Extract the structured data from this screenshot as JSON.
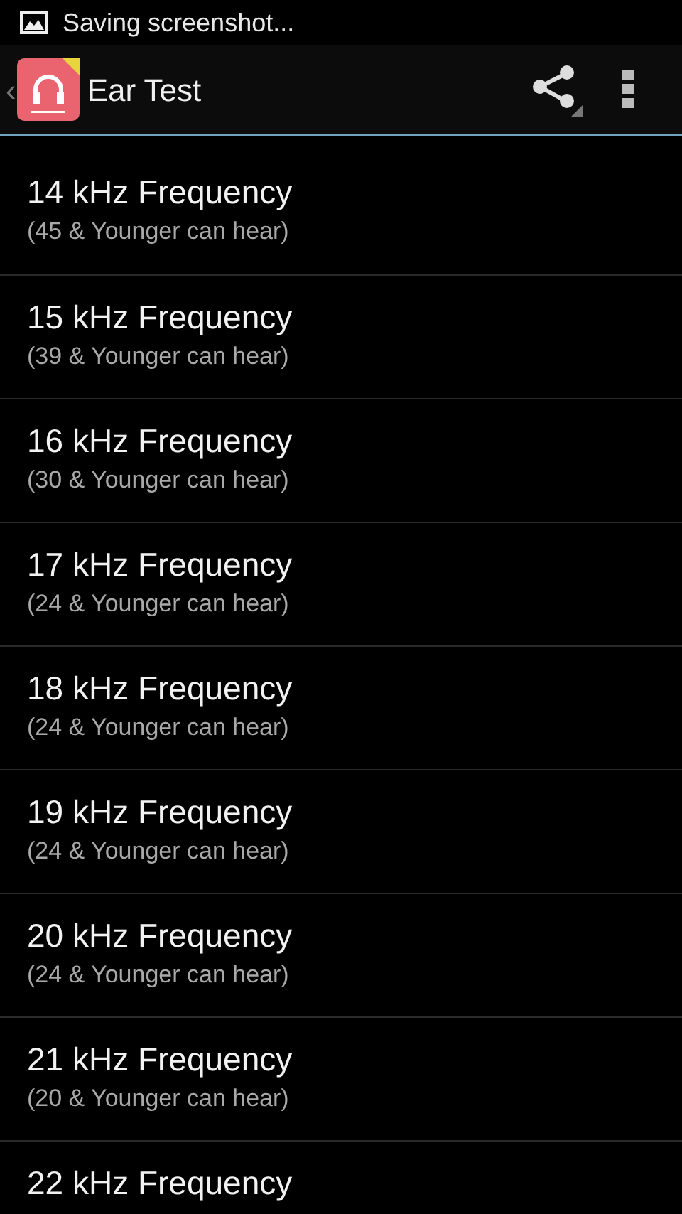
{
  "status_bar": {
    "notification": "Saving screenshot..."
  },
  "action_bar": {
    "back": "‹",
    "title": "Ear Test"
  },
  "items": [
    {
      "title": "14 kHz Frequency",
      "subtitle": "(45 & Younger can hear)"
    },
    {
      "title": "15 kHz Frequency",
      "subtitle": "(39 & Younger can hear)"
    },
    {
      "title": "16 kHz Frequency",
      "subtitle": "(30 & Younger can hear)"
    },
    {
      "title": "17 kHz Frequency",
      "subtitle": "(24 & Younger can hear)"
    },
    {
      "title": "18 kHz Frequency",
      "subtitle": "(24 & Younger can hear)"
    },
    {
      "title": "19 kHz Frequency",
      "subtitle": "(24 & Younger can hear)"
    },
    {
      "title": "20 kHz Frequency",
      "subtitle": "(24 & Younger can hear)"
    },
    {
      "title": "21 kHz Frequency",
      "subtitle": "(20 & Younger can hear)"
    },
    {
      "title": "22 kHz Frequency"
    }
  ]
}
